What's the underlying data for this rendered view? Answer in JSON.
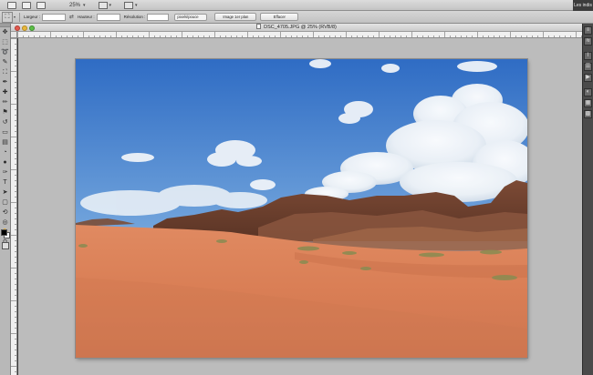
{
  "app_bar": {
    "zoom": "25%",
    "workspace_button": "Les indis"
  },
  "options_bar": {
    "width_label": "Largeur :",
    "height_label": "Hauteur :",
    "resolution_label": "Résolution :",
    "unit_select": "pixels/pouce",
    "front_image_button": "Image 1er plan",
    "clear_button": "Effacer",
    "width_value": "",
    "height_value": "",
    "resolution_value": ""
  },
  "document": {
    "title": "DSC_4705.JPG @ 25% (RVB/8)"
  },
  "tools": [
    {
      "icon": "move-icon",
      "glyph": "✥"
    },
    {
      "icon": "marquee-icon",
      "glyph": "⬚"
    },
    {
      "icon": "lasso-icon",
      "glyph": "➰"
    },
    {
      "icon": "quick-select-icon",
      "glyph": "✎"
    },
    {
      "icon": "crop-icon",
      "glyph": "⛶"
    },
    {
      "icon": "eyedropper-icon",
      "glyph": "✒"
    },
    {
      "icon": "healing-brush-icon",
      "glyph": "✚"
    },
    {
      "icon": "brush-icon",
      "glyph": "✏"
    },
    {
      "icon": "clone-stamp-icon",
      "glyph": "⚑"
    },
    {
      "icon": "history-brush-icon",
      "glyph": "↺"
    },
    {
      "icon": "eraser-icon",
      "glyph": "▭"
    },
    {
      "icon": "gradient-icon",
      "glyph": "▤"
    },
    {
      "icon": "blur-icon",
      "glyph": "◔"
    },
    {
      "icon": "dodge-icon",
      "glyph": "●"
    },
    {
      "icon": "pen-icon",
      "glyph": "✑"
    },
    {
      "icon": "type-icon",
      "glyph": "T"
    },
    {
      "icon": "path-select-icon",
      "glyph": "➤"
    },
    {
      "icon": "shape-icon",
      "glyph": "▢"
    },
    {
      "icon": "3d-rotate-icon",
      "glyph": "⟲"
    },
    {
      "icon": "3d-orbit-icon",
      "glyph": "◎"
    },
    {
      "icon": "hand-icon",
      "glyph": "✋"
    },
    {
      "icon": "zoom-icon",
      "glyph": "⚲"
    }
  ],
  "dock_tools": [
    {
      "icon": "layers-icon",
      "glyph": "≡"
    },
    {
      "icon": "channels-icon",
      "glyph": "≋"
    },
    {
      "icon": "paths-icon",
      "glyph": "⌇"
    },
    {
      "icon": "history-icon",
      "glyph": "☰"
    },
    {
      "icon": "actions-icon",
      "glyph": "▶"
    },
    {
      "icon": "adjustments-icon",
      "glyph": "◐"
    },
    {
      "icon": "styles-icon",
      "glyph": "▦"
    },
    {
      "icon": "swatches-icon",
      "glyph": "▩"
    }
  ],
  "colors": {
    "sky_top": "#3d78c9",
    "sky_bottom": "#a9c8e8",
    "sand": "#d8805a",
    "rock": "#6f3f2c"
  }
}
